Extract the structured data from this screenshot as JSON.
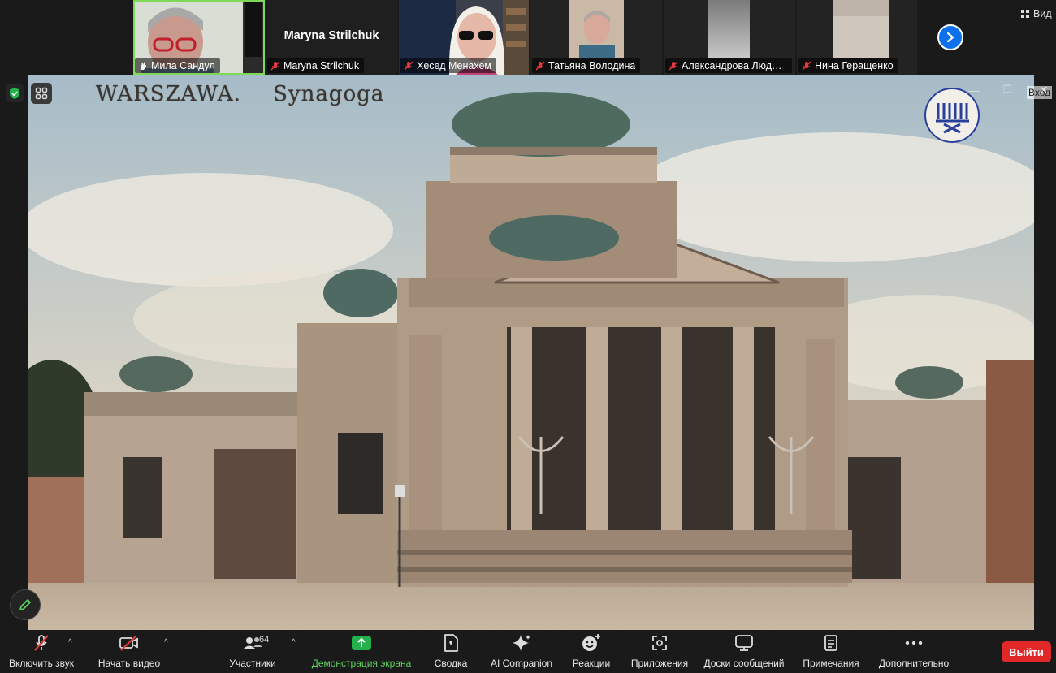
{
  "participants": [
    {
      "name": "Мила Сандул",
      "state": "speaking",
      "icon": "hand-icon"
    },
    {
      "name": "Maryna Strilchuk",
      "state": "muted",
      "video": "off"
    },
    {
      "name": "Хесед Менахем",
      "state": "muted"
    },
    {
      "name": "Татьяна Володина",
      "state": "muted"
    },
    {
      "name": "Александрова Людм...",
      "state": "muted"
    },
    {
      "name": "Нина Геращенко",
      "state": "muted"
    }
  ],
  "view_button": "Вид",
  "shared_screen": {
    "caption_city": "WARSZAWA.",
    "caption_subject": "Synagoga",
    "exit_label": "Вход"
  },
  "toolbar": {
    "unmute": "Включить звук",
    "start_video": "Начать видео",
    "participants": "Участники",
    "participants_count": "64",
    "share_screen": "Демонстрация экрана",
    "summary": "Сводка",
    "ai_companion": "AI Companion",
    "reactions": "Реакции",
    "apps": "Приложения",
    "whiteboards": "Доски сообщений",
    "notes": "Примечания",
    "more": "Дополнительно",
    "leave": "Выйти"
  },
  "colors": {
    "accent_blue": "#0e71eb",
    "share_green": "#5fd35f",
    "leave_red": "#e02828",
    "muted_red": "#e03a3a"
  }
}
